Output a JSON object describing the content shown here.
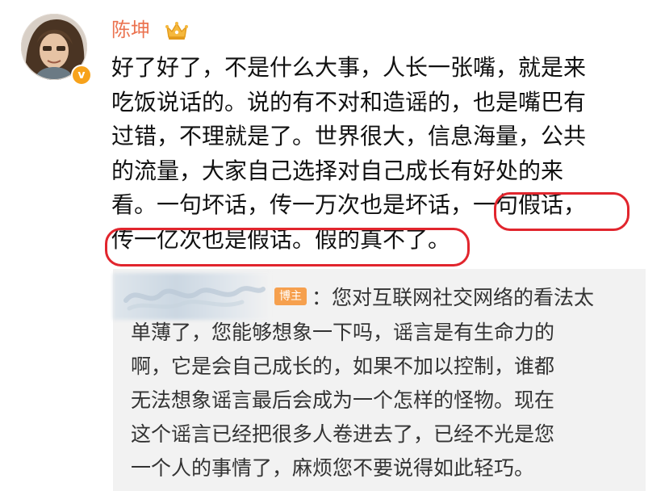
{
  "author": {
    "name": "陈坤",
    "crown_icon": "crown-icon",
    "verified_badge": "v",
    "badge_color": "#f7a21b",
    "name_color": "#eb7350"
  },
  "post": {
    "lines": [
      "好了好了，不是什么大事，人长一张嘴，就是来",
      "吃饭说话的。说的有不对和造谣的，也是嘴巴有",
      "过错，不理就是了。世界很大，信息海量，公共",
      "的流量，大家自己选择对自己成长有好处的来",
      "看。一句坏话，传一万次也是坏话，一句假话，",
      "传一亿次也是假话。假的真不了。"
    ],
    "highlight_color": "#e1252d"
  },
  "reply": {
    "op_label": "博主",
    "first_line": "：您对互联网社交网络的看法太",
    "lines": [
      "单薄了，您能够想象一下吗，谣言是有生命力的",
      "啊，它是会自己成长的，如果不加以控制，谁都",
      "无法想象谣言最后会成为一个怎样的怪物。现在",
      "这个谣言已经把很多人卷进去了，已经不光是您",
      "一个人的事情了，麻烦您不要说得如此轻巧。"
    ],
    "op_badge_color": "#f6a04e",
    "background": "#f2f2f2"
  }
}
